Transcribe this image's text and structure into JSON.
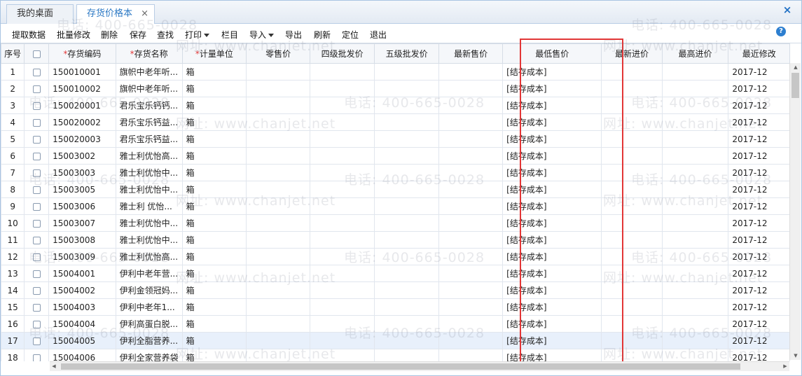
{
  "tabs": {
    "desk_label": "我的桌面",
    "active_label": "存货价格本",
    "close_glyph": "×"
  },
  "window_close_glyph": "×",
  "help_glyph": "?",
  "toolbar": {
    "fetch": "提取数据",
    "batch_edit": "批量修改",
    "delete": "删除",
    "save": "保存",
    "find": "查找",
    "print": "打印",
    "columns": "栏目",
    "import": "导入",
    "export": "导出",
    "refresh": "刷新",
    "locate": "定位",
    "exit": "退出"
  },
  "columns": {
    "seq": "序号",
    "code": "存货编码",
    "name": "存货名称",
    "unit": "计量单位",
    "retail": "零售价",
    "level4": "四级批发价",
    "level5": "五级批发价",
    "latest_sale": "最新售价",
    "min_sale": "最低售价",
    "latest_purchase": "最新进价",
    "max_purchase": "最高进价",
    "recent_modified": "最近修改"
  },
  "required_mark": "*",
  "rows": [
    {
      "seq": "1",
      "code": "150010001",
      "name": "旗帜中老年听...",
      "unit": "箱",
      "min_sale": "[结存成本]",
      "recent": "2017-12"
    },
    {
      "seq": "2",
      "code": "150010002",
      "name": "旗帜中老年听...",
      "unit": "箱",
      "min_sale": "[结存成本]",
      "recent": "2017-12"
    },
    {
      "seq": "3",
      "code": "150020001",
      "name": "君乐宝乐钙钙...",
      "unit": "箱",
      "min_sale": "[结存成本]",
      "recent": "2017-12"
    },
    {
      "seq": "4",
      "code": "150020002",
      "name": "君乐宝乐钙益...",
      "unit": "箱",
      "min_sale": "[结存成本]",
      "recent": "2017-12"
    },
    {
      "seq": "5",
      "code": "150020003",
      "name": "君乐宝乐钙益...",
      "unit": "箱",
      "min_sale": "[结存成本]",
      "recent": "2017-12"
    },
    {
      "seq": "6",
      "code": "15003002",
      "name": "雅士利优怡高...",
      "unit": "箱",
      "min_sale": "[结存成本]",
      "recent": "2017-12"
    },
    {
      "seq": "7",
      "code": "15003003",
      "name": "雅士利优怡中...",
      "unit": "箱",
      "min_sale": "[结存成本]",
      "recent": "2017-12"
    },
    {
      "seq": "8",
      "code": "15003005",
      "name": "雅士利优怡中...",
      "unit": "箱",
      "min_sale": "[结存成本]",
      "recent": "2017-12"
    },
    {
      "seq": "9",
      "code": "15003006",
      "name": "雅士利 优怡...",
      "unit": "箱",
      "min_sale": "[结存成本]",
      "recent": "2017-12"
    },
    {
      "seq": "10",
      "code": "15003007",
      "name": "雅士利优怡中...",
      "unit": "箱",
      "min_sale": "[结存成本]",
      "recent": "2017-12"
    },
    {
      "seq": "11",
      "code": "15003008",
      "name": "雅士利优怡中...",
      "unit": "箱",
      "min_sale": "[结存成本]",
      "recent": "2017-12"
    },
    {
      "seq": "12",
      "code": "15003009",
      "name": "雅士利优怡高...",
      "unit": "箱",
      "min_sale": "[结存成本]",
      "recent": "2017-12"
    },
    {
      "seq": "13",
      "code": "15004001",
      "name": "伊利中老年营...",
      "unit": "箱",
      "min_sale": "[结存成本]",
      "recent": "2017-12"
    },
    {
      "seq": "14",
      "code": "15004002",
      "name": "伊利金领冠妈...",
      "unit": "箱",
      "min_sale": "[结存成本]",
      "recent": "2017-12"
    },
    {
      "seq": "15",
      "code": "15004003",
      "name": "伊利中老年1...",
      "unit": "箱",
      "min_sale": "[结存成本]",
      "recent": "2017-12"
    },
    {
      "seq": "16",
      "code": "15004004",
      "name": "伊利高蛋白脱...",
      "unit": "箱",
      "min_sale": "[结存成本]",
      "recent": "2017-12"
    },
    {
      "seq": "17",
      "code": "15004005",
      "name": "伊利全脂营养...",
      "unit": "箱",
      "min_sale": "[结存成本]",
      "recent": "2017-12"
    },
    {
      "seq": "18",
      "code": "15004006",
      "name": "伊利全家营养袋",
      "unit": "箱",
      "min_sale": "[结存成本]",
      "recent": "2017-12"
    }
  ],
  "watermarks": {
    "phone": "电话: 400-665-0028",
    "site": "网址: www.chanjet.net"
  }
}
